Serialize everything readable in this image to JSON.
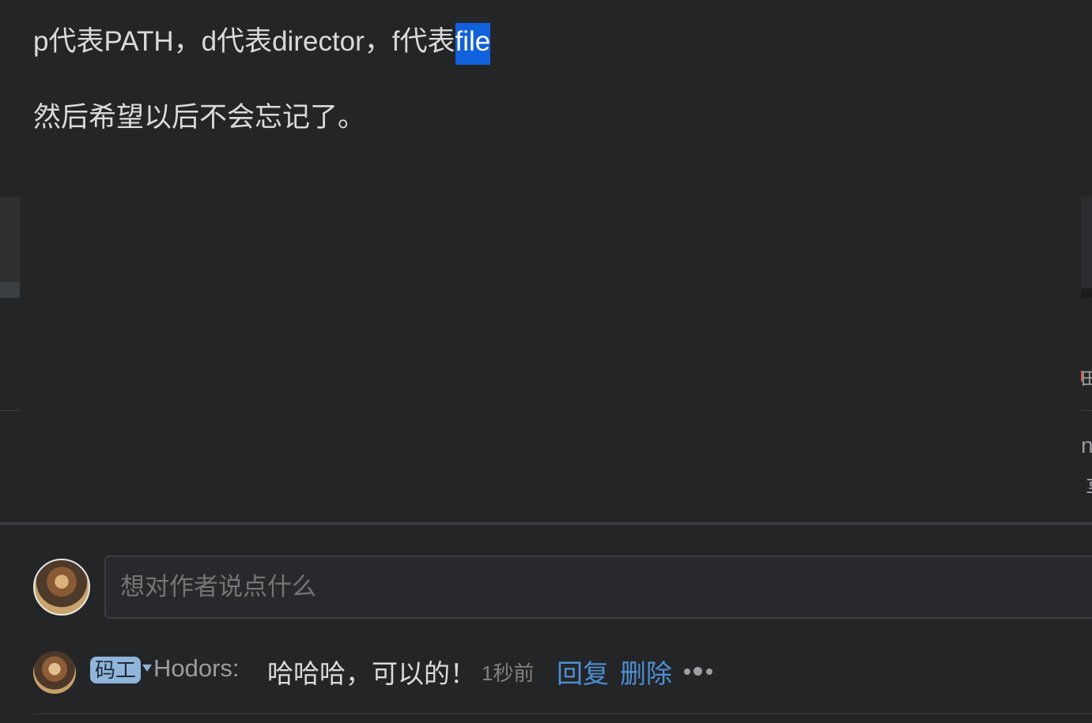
{
  "article": {
    "line1_prefix": "p代表PATH，d代表director，f代表",
    "line1_selected": "file",
    "line2": "然后希望以后不会忘记了。"
  },
  "edges": {
    "right_mark": "田",
    "right_n": "n",
    "right_x": "享"
  },
  "comment_input": {
    "placeholder": "想对作者说点什么"
  },
  "comment": {
    "badge": "码工",
    "username": "Hodors:",
    "text": "哈哈哈，可以的！",
    "time": "1秒前",
    "reply_label": "回复",
    "delete_label": "删除",
    "more_icon": "more-dots-icon"
  },
  "colors": {
    "background": "#242527",
    "selection": "#1160dc",
    "link": "#4e8fd3",
    "badge": "#8fb5da"
  }
}
